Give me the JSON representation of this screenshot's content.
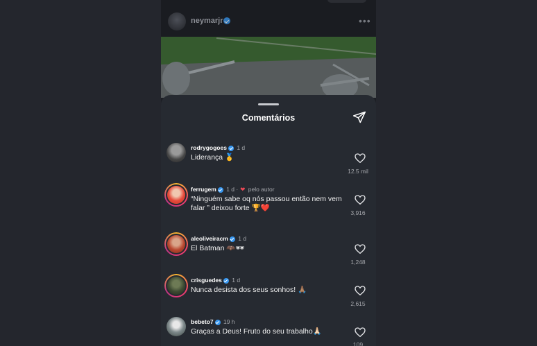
{
  "post": {
    "username": "neymarjr",
    "more_icon": "more-horizontal-icon"
  },
  "sheet": {
    "title": "Comentários",
    "send_icon": "send-paper-plane-icon"
  },
  "comments": [
    {
      "username": "rodrygogoes",
      "time": "1 d",
      "text": "Liderança 🥇",
      "likes": "12.5 mil",
      "story_ring": false
    },
    {
      "username": "ferrugem",
      "time": "1 d ·",
      "author_tag": "pelo autor",
      "text": "“Ninguém sabe oq nós passou então nem vem falar ” deixou forte 🏆❤️",
      "likes": "3,916",
      "story_ring": true
    },
    {
      "username": "aleoliveiracm",
      "time": "1 d",
      "text": "El Batman 🦇🕶",
      "likes": "1,248",
      "story_ring": true
    },
    {
      "username": "crisguedes",
      "time": "1 d",
      "text": "Nunca desista dos seus sonhos! 🙏🏽",
      "likes": "2,615",
      "story_ring": true
    },
    {
      "username": "bebeto7",
      "time": "19 h",
      "text": "Graças a Deus! Fruto do seu trabalho🙏🏻",
      "likes": "109",
      "story_ring": false
    }
  ],
  "colors": {
    "verified": "#3897f0",
    "liked_by_author_heart": "#ed4956",
    "sheet_background": "#262a31"
  }
}
